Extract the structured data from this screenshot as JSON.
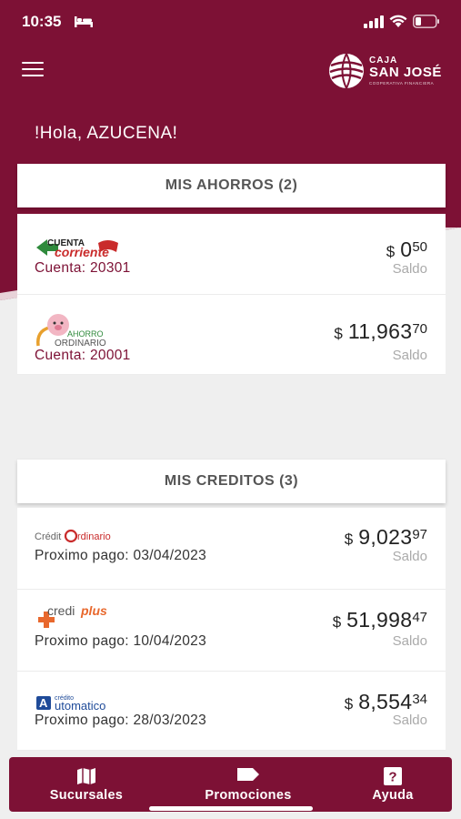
{
  "status_bar": {
    "time": "10:35"
  },
  "header": {
    "logo": {
      "line1": "CAJA",
      "line2": "SAN JOSÉ",
      "line3": "COOPERATIVA FINANCIERA"
    },
    "greeting": "!Hola, AZUCENA!"
  },
  "ahorros": {
    "title": "MIS AHORROS (2)",
    "items": [
      {
        "logo_text_1": "CUENTA",
        "logo_text_2": "corriente",
        "subtitle": "Cuenta: 20301",
        "currency": "$",
        "amount_int": "0",
        "amount_dec": "50",
        "label": "Saldo"
      },
      {
        "logo_text_1": "AHORRO",
        "logo_text_2": "ORDINARIO",
        "subtitle": "Cuenta: 20001",
        "currency": "$",
        "amount_int": "11,963",
        "amount_dec": "70",
        "label": "Saldo"
      }
    ]
  },
  "creditos": {
    "title": "MIS CREDITOS (3)",
    "items": [
      {
        "logo_text_1": "Crédit",
        "logo_text_2": "rdinario",
        "subtitle": "Proximo pago: 03/04/2023",
        "currency": "$",
        "amount_int": "9,023",
        "amount_dec": "97",
        "label": "Saldo"
      },
      {
        "logo_text_1": "credi",
        "logo_text_2": "plus",
        "subtitle": "Proximo pago: 10/04/2023",
        "currency": "$",
        "amount_int": "51,998",
        "amount_dec": "47",
        "label": "Saldo"
      },
      {
        "logo_text_1": "crédito",
        "logo_text_2": "utomatico",
        "subtitle": "Proximo pago: 28/03/2023",
        "currency": "$",
        "amount_int": "8,554",
        "amount_dec": "34",
        "label": "Saldo"
      }
    ]
  },
  "bottom_nav": [
    {
      "label": "Sucursales",
      "icon": "map-icon"
    },
    {
      "label": "Promociones",
      "icon": "tag-icon"
    },
    {
      "label": "Ayuda",
      "icon": "help-icon"
    }
  ],
  "colors": {
    "brand": "#7d1135",
    "background": "#efefef"
  }
}
